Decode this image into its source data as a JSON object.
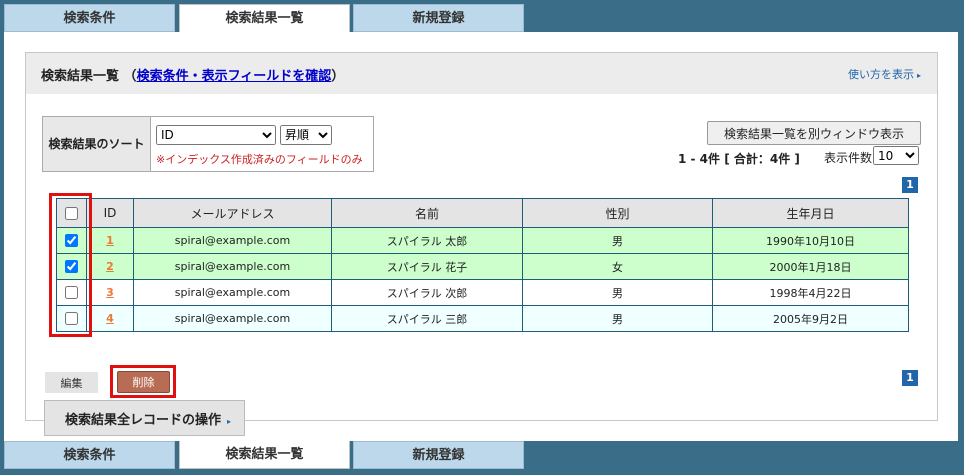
{
  "tabs": [
    "検索条件",
    "検索結果一覧",
    "新規登録"
  ],
  "header": {
    "title": "検索結果一覧",
    "paren_open": "（",
    "link": "検索条件・表示フィールドを確認",
    "paren_close": "）",
    "help": "使い方を表示",
    "help_arrow": "▸"
  },
  "sort": {
    "label": "検索結果のソート",
    "field": "ID",
    "order": "昇順",
    "note": "※インデックス作成済みのフィールドのみ"
  },
  "window_button": "検索結果一覧を別ウィンドウ表示",
  "count_text": "1 - 4件 [ 合計：4件 ]",
  "perpage_label": "表示件数",
  "perpage_value": "10",
  "page_number": "1",
  "table": {
    "columns": [
      "ID",
      "メールアドレス",
      "名前",
      "性別",
      "生年月日"
    ],
    "rows": [
      {
        "checked": true,
        "id": "1",
        "email": "spiral@example.com",
        "name": "スパイラル 太郎",
        "gender": "男",
        "birthday": "1990年10月10日"
      },
      {
        "checked": true,
        "id": "2",
        "email": "spiral@example.com",
        "name": "スパイラル 花子",
        "gender": "女",
        "birthday": "2000年1月18日"
      },
      {
        "checked": false,
        "id": "3",
        "email": "spiral@example.com",
        "name": "スパイラル 次郎",
        "gender": "男",
        "birthday": "1998年4月22日"
      },
      {
        "checked": false,
        "id": "4",
        "email": "spiral@example.com",
        "name": "スパイラル 三郎",
        "gender": "男",
        "birthday": "2005年9月2日"
      }
    ]
  },
  "buttons": {
    "edit": "編集",
    "delete": "削除",
    "all_records": "検索結果全レコードの操作",
    "all_records_arrow": "▸"
  },
  "colors": {
    "background": "#3a6e88",
    "highlight": "#e01010",
    "checked_row": "#ccffcc",
    "alt_row": "#f0ffff",
    "delete_button": "#b86c54"
  }
}
